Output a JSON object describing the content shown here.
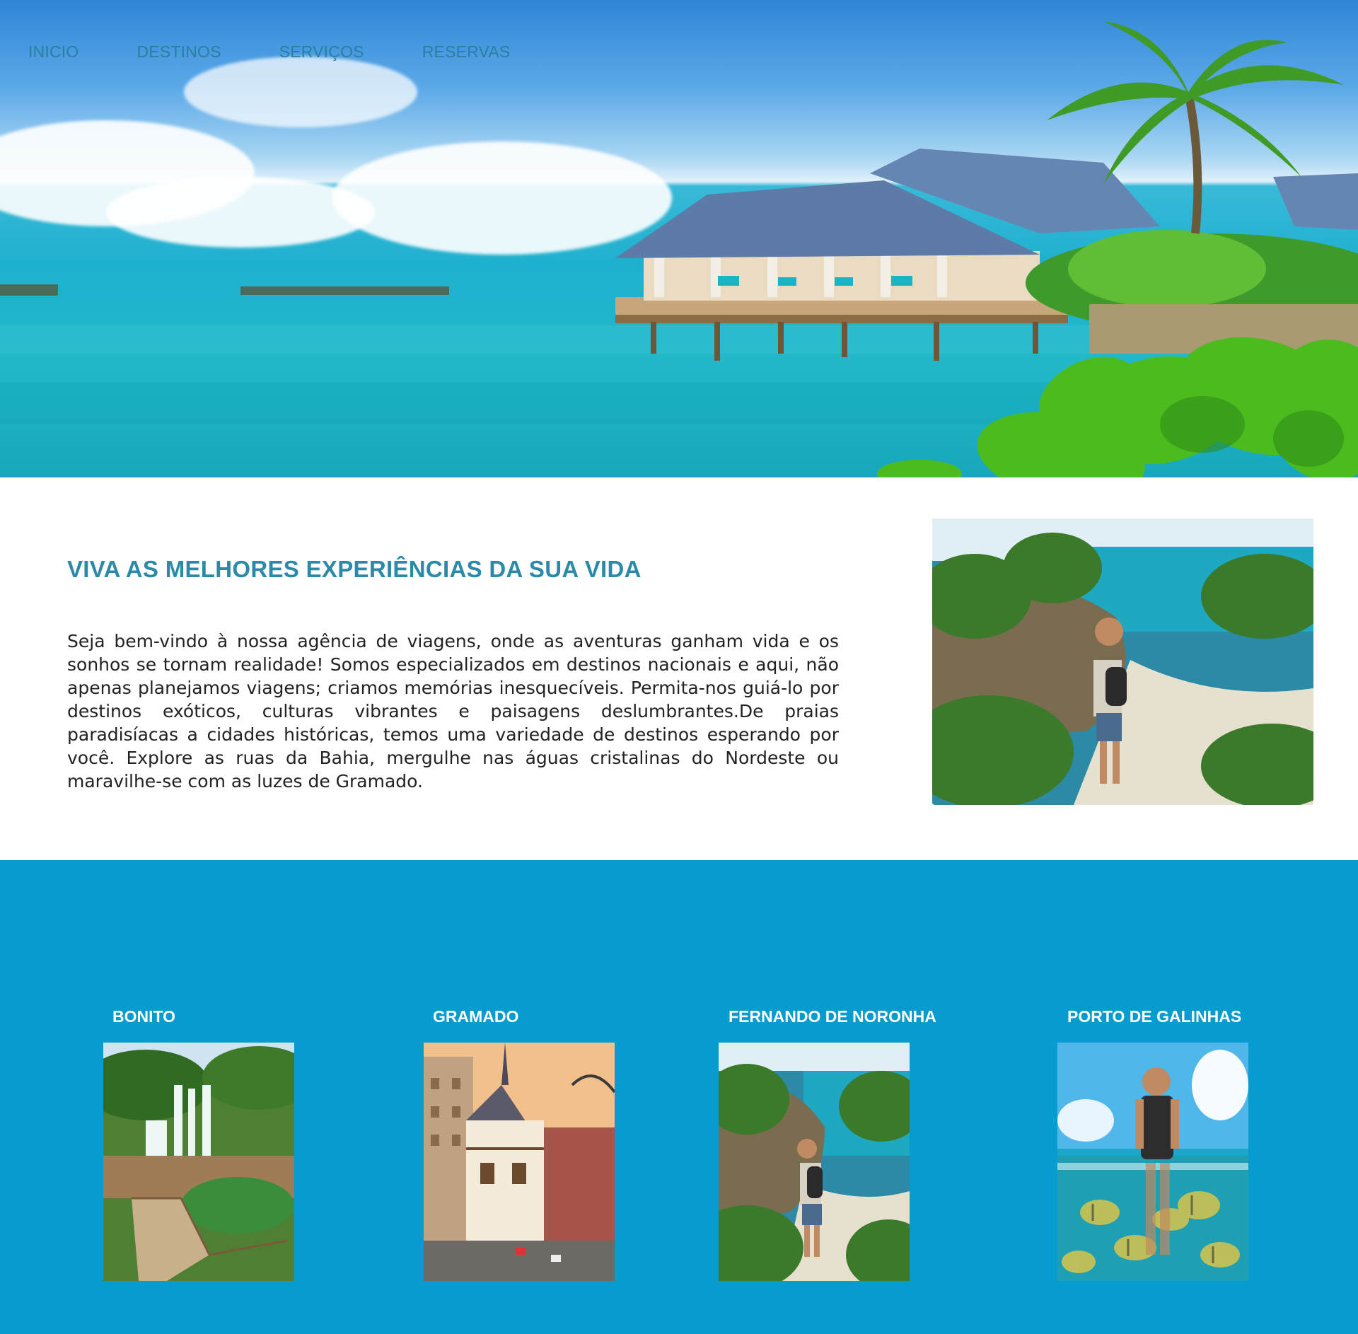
{
  "nav": {
    "items": [
      {
        "label": "INICIO"
      },
      {
        "label": "DESTINOS"
      },
      {
        "label": "SERVIÇOS"
      },
      {
        "label": "RESERVAS"
      }
    ]
  },
  "intro": {
    "title": "VIVA AS MELHORES EXPERIÊNCIAS DA SUA VIDA",
    "text": "Seja bem-vindo à nossa agência de viagens, onde as aventuras ganham vida e os sonhos se tornam realidade! Somos especializados em destinos nacionais e aqui, não apenas planejamos viagens; criamos memórias inesquecíveis. Permita-nos guiá-lo por destinos exóticos, culturas vibrantes e paisagens deslumbrantes.De praias paradisíacas a cidades históricas, temos uma variedade de destinos esperando por você. Explore as ruas da Bahia, mergulhe nas águas cristalinas do Nordeste ou maravilhe-se com as luzes de Gramado."
  },
  "destinations": [
    {
      "name": "BONITO"
    },
    {
      "name": "GRAMADO"
    },
    {
      "name": "FERNANDO DE NORONHA"
    },
    {
      "name": "PORTO DE GALINHAS"
    }
  ],
  "colors": {
    "nav_text": "#2b7f9e",
    "title": "#2b8aa8",
    "section_bg": "#069ccf",
    "card_title": "#ffffff"
  }
}
